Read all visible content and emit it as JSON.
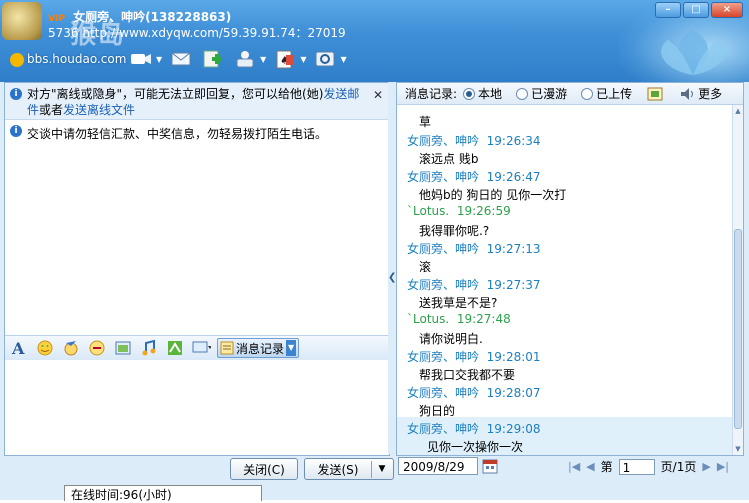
{
  "window": {
    "contact_name": "女厕旁、呻吟",
    "contact_id": "(138228863)",
    "status_marker": "VIP",
    "subtitle_prefix": "5736",
    "subtitle_url": "http://www.xdyqw.com/59.39.91.74：27019",
    "watermark_text": "猴岛",
    "watermark_url": "bbs.houdao.com",
    "accent_color": "#3f8fd8"
  },
  "toolbar": {
    "icons": [
      "video-icon",
      "voice-icon",
      "mail-icon",
      "transfer-icon",
      "apps-icon",
      "games-icon",
      "settings-icon"
    ]
  },
  "notice": {
    "text_prefix": "对方\"离线或隐身\"，可能无法立即回复，您可以给他(她)",
    "link1": "发送邮件",
    "middle": "或者",
    "link2": "发送离线文件"
  },
  "warning": "交谈中请勿轻信汇款、中奖信息，勿轻易拨打陌生电话。",
  "format_bar": {
    "msg_record_label": "消息记录"
  },
  "buttons": {
    "close_label": "关闭(C)",
    "send_label": "发送(S)"
  },
  "online_tab": "在线时间:96(小时)",
  "history": {
    "title": "消息记录:",
    "opt_local": "本地",
    "opt_roam": "已漫游",
    "opt_upload": "已上传",
    "more": "更多",
    "messages": [
      {
        "sender": "女厕旁、呻吟",
        "time": "",
        "text": "草"
      },
      {
        "sender": "女厕旁、呻吟",
        "time": "19:26:34",
        "text": "滚远点  贱b"
      },
      {
        "sender": "女厕旁、呻吟",
        "time": "19:26:47",
        "text": "他妈b的  狗日的  见你一次打"
      },
      {
        "sender": "`Lotus.",
        "time": "19:26:59",
        "text": "我得罪你呢.?"
      },
      {
        "sender": "女厕旁、呻吟",
        "time": "19:27:13",
        "text": "滚"
      },
      {
        "sender": "女厕旁、呻吟",
        "time": "19:27:37",
        "text": "送我草是不是?"
      },
      {
        "sender": "`Lotus.",
        "time": "19:27:48",
        "text": "请你说明白."
      },
      {
        "sender": "女厕旁、呻吟",
        "time": "19:28:01",
        "text": "帮我口交我都不要"
      },
      {
        "sender": "女厕旁、呻吟",
        "time": "19:28:07",
        "text": "狗日的"
      },
      {
        "sender": "女厕旁、呻吟",
        "time": "19:29:08",
        "text": "见你一次操你一次"
      }
    ]
  },
  "footer": {
    "date": "2009/8/29",
    "page_prefix": "第",
    "page_value": "1",
    "page_suffix": "页/1页"
  }
}
